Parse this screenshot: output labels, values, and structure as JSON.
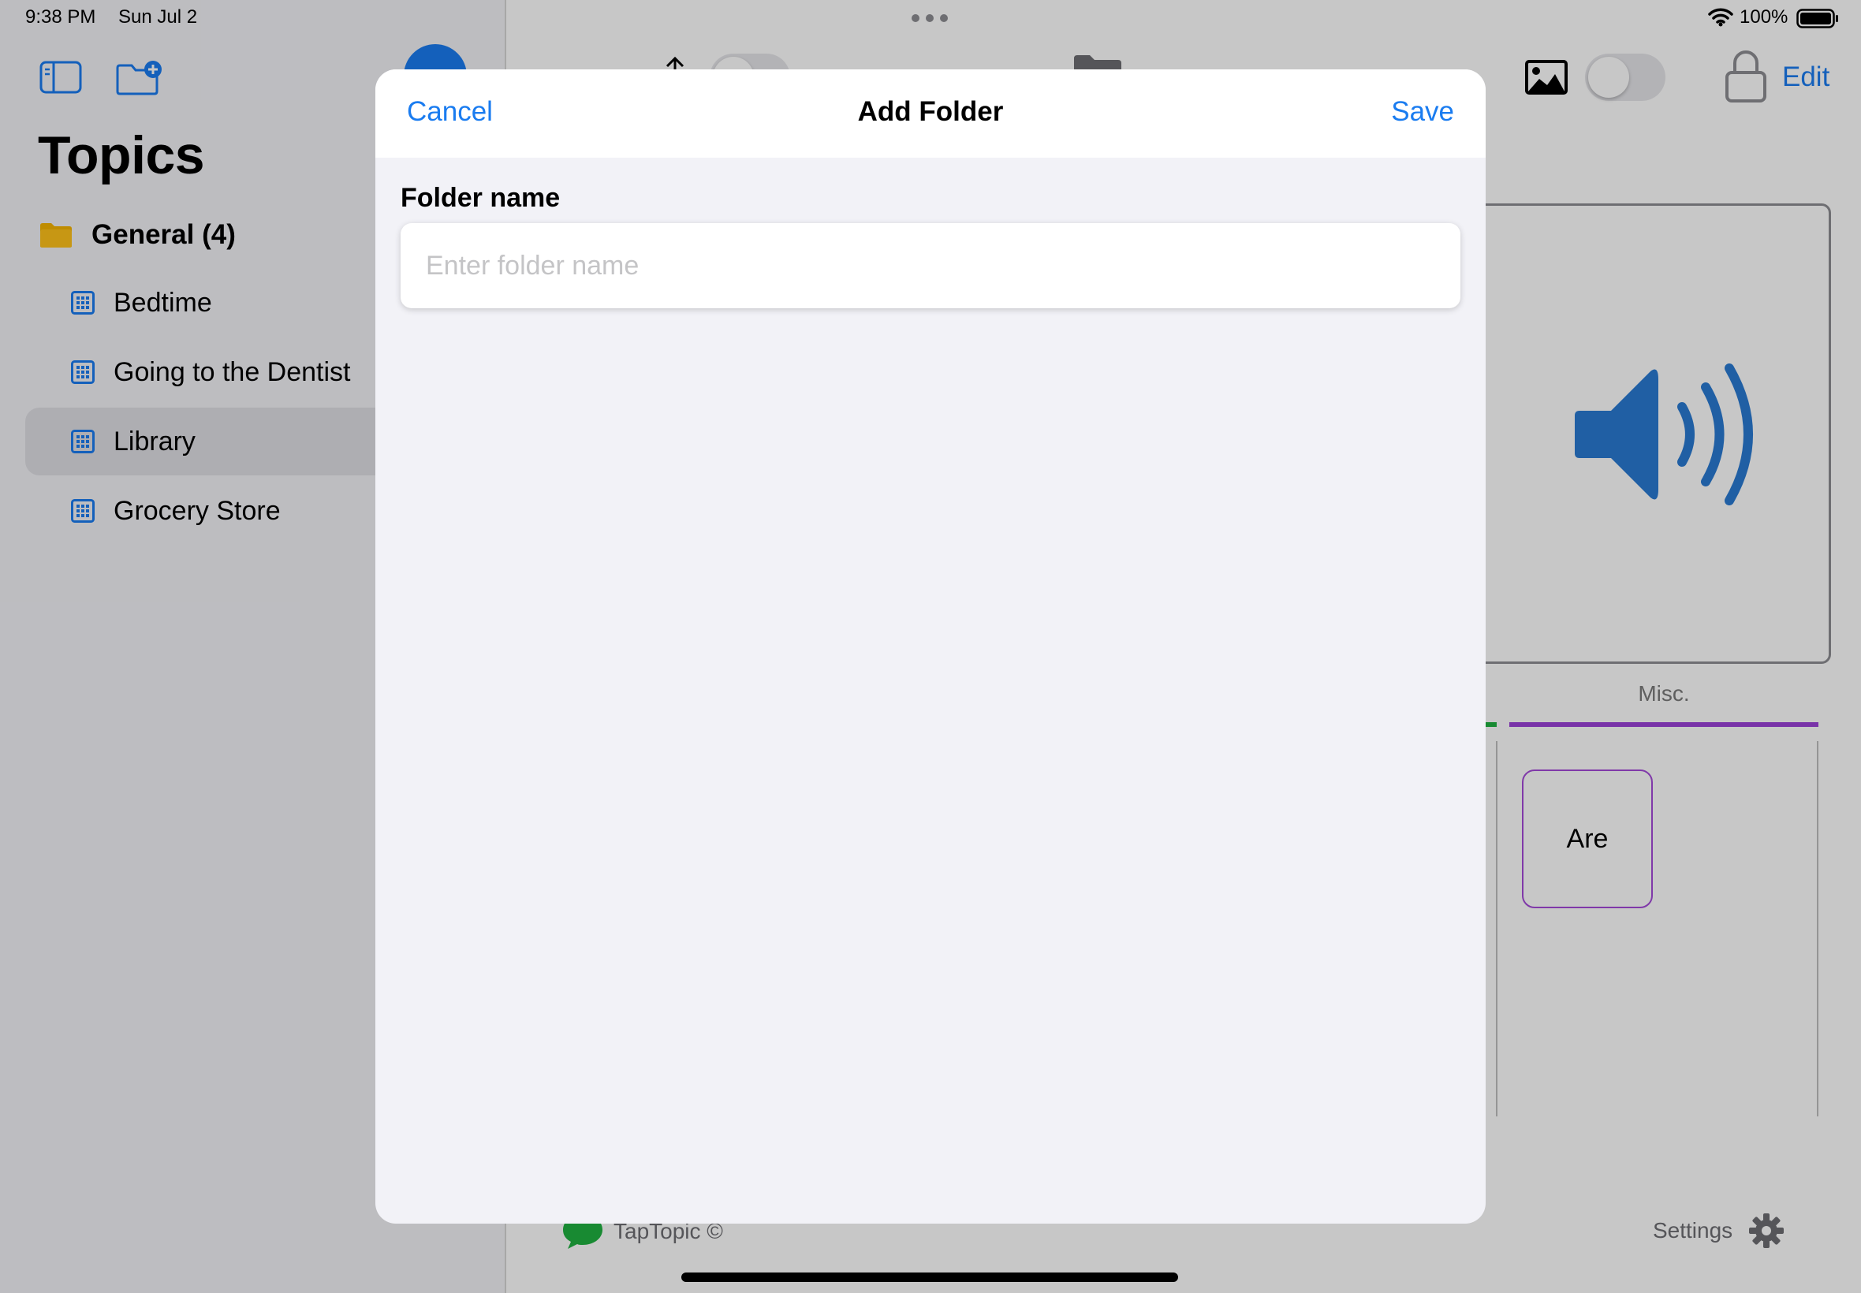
{
  "status_bar": {
    "time": "9:38 PM",
    "date": "Sun Jul 2",
    "battery_percent": "100%"
  },
  "sidebar": {
    "title": "Topics",
    "folder": {
      "label": "General (4)"
    },
    "topics": [
      {
        "label": "Bedtime"
      },
      {
        "label": "Going to the Dentist"
      },
      {
        "label": "Library",
        "selected": true
      },
      {
        "label": "Grocery Store"
      }
    ]
  },
  "toolbar": {
    "edit_label": "Edit"
  },
  "content": {
    "category_label": "Misc.",
    "tile_label": "Are",
    "brand_label": "TapTopic ©",
    "settings_label": "Settings"
  },
  "modal": {
    "cancel_label": "Cancel",
    "title": "Add Folder",
    "save_label": "Save",
    "field_label": "Folder name",
    "input_placeholder": "Enter folder name",
    "input_value": ""
  },
  "colors": {
    "accent": "#1a7cf0",
    "folder_yellow": "#f5b400",
    "misc_purple": "#9b42d8",
    "green": "#1fb141"
  }
}
